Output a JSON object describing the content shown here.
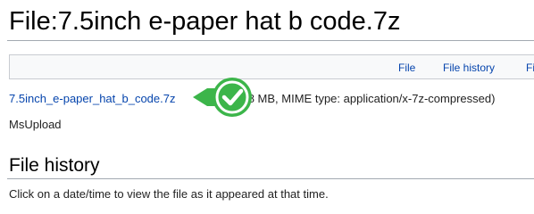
{
  "page": {
    "title": "File:7.5inch e-paper hat b code.7z"
  },
  "filetoc": {
    "items": [
      {
        "label": "File"
      },
      {
        "label": "File history"
      },
      {
        "label": "Fi"
      }
    ]
  },
  "fullmedia": {
    "filename": "7.5inch_e-paper_hat_b_code.7z",
    "details": "78 MB, MIME type: application/x-7z-compressed)"
  },
  "msupload": {
    "label": "MsUpload"
  },
  "file_history": {
    "heading": "File history",
    "hint": "Click on a date/time to view the file as it appeared at that time."
  },
  "badge": {
    "icon": "checkmark-icon",
    "color": "#3cb54a"
  }
}
